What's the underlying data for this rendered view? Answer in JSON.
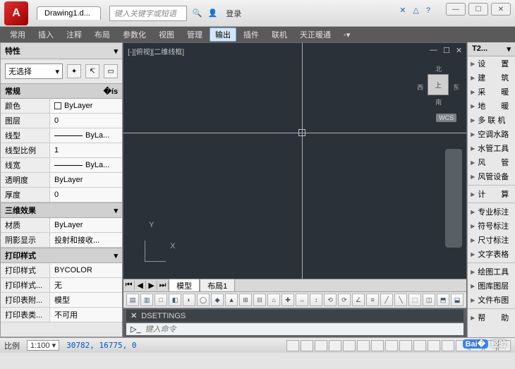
{
  "title": {
    "app_letter": "A",
    "doc": "Drawing1.d...",
    "search_placeholder": "键入关键字或短语",
    "login": "登录"
  },
  "win": {
    "min": "—",
    "max": "☐",
    "close": "✕"
  },
  "menu": [
    "常用",
    "插入",
    "注释",
    "布局",
    "参数化",
    "视图",
    "管理",
    "输出",
    "插件",
    "联机",
    "天正暖通"
  ],
  "menu_active_index": 7,
  "props": {
    "title": "特性",
    "selector": "无选择",
    "sections": {
      "general": "常规",
      "three_d": "三维效果",
      "print": "打印样式"
    },
    "rows_general": [
      {
        "k": "颜色",
        "v": "ByLayer",
        "swatch": true
      },
      {
        "k": "图层",
        "v": "0"
      },
      {
        "k": "线型",
        "v": "ByLa...",
        "line": true
      },
      {
        "k": "线型比例",
        "v": "1"
      },
      {
        "k": "线宽",
        "v": "ByLa...",
        "line": true
      },
      {
        "k": "透明度",
        "v": "ByLayer"
      },
      {
        "k": "厚度",
        "v": "0"
      }
    ],
    "rows_3d": [
      {
        "k": "材质",
        "v": "ByLayer"
      },
      {
        "k": "阴影显示",
        "v": "投射和接收..."
      }
    ],
    "rows_print": [
      {
        "k": "打印样式",
        "v": "BYCOLOR"
      },
      {
        "k": "打印样式...",
        "v": "无"
      },
      {
        "k": "打印表附...",
        "v": "模型"
      },
      {
        "k": "打印表类...",
        "v": "不可用"
      }
    ]
  },
  "viewport": {
    "label": "[-][俯视][二维线框]",
    "wcs": "WCS",
    "cube": {
      "n": "北",
      "s": "南",
      "e": "东",
      "w": "西",
      "top": "上"
    },
    "axes": {
      "x": "X",
      "y": "Y"
    }
  },
  "mtabs": {
    "model": "模型",
    "layout1": "布局1"
  },
  "cmd": {
    "out": "DSETTINGS",
    "placeholder": "键入命令"
  },
  "rpal": {
    "title": "T2...",
    "groups": [
      [
        "设　　置",
        "建　　筑",
        "采　　暖",
        "地　　暖",
        "多 联 机",
        "空调水路",
        "水管工具",
        "风　　管",
        "风管设备"
      ],
      [
        "计　　算"
      ],
      [
        "专业标注",
        "符号标注",
        "尺寸标注",
        "文字表格"
      ],
      [
        "绘图工具",
        "图库图层",
        "文件布图"
      ],
      [
        "帮　　助"
      ]
    ]
  },
  "status": {
    "scale_label": "比例",
    "scale_value": "1:100",
    "coords": "30782, 16775, 0"
  },
  "watermark": "经验"
}
